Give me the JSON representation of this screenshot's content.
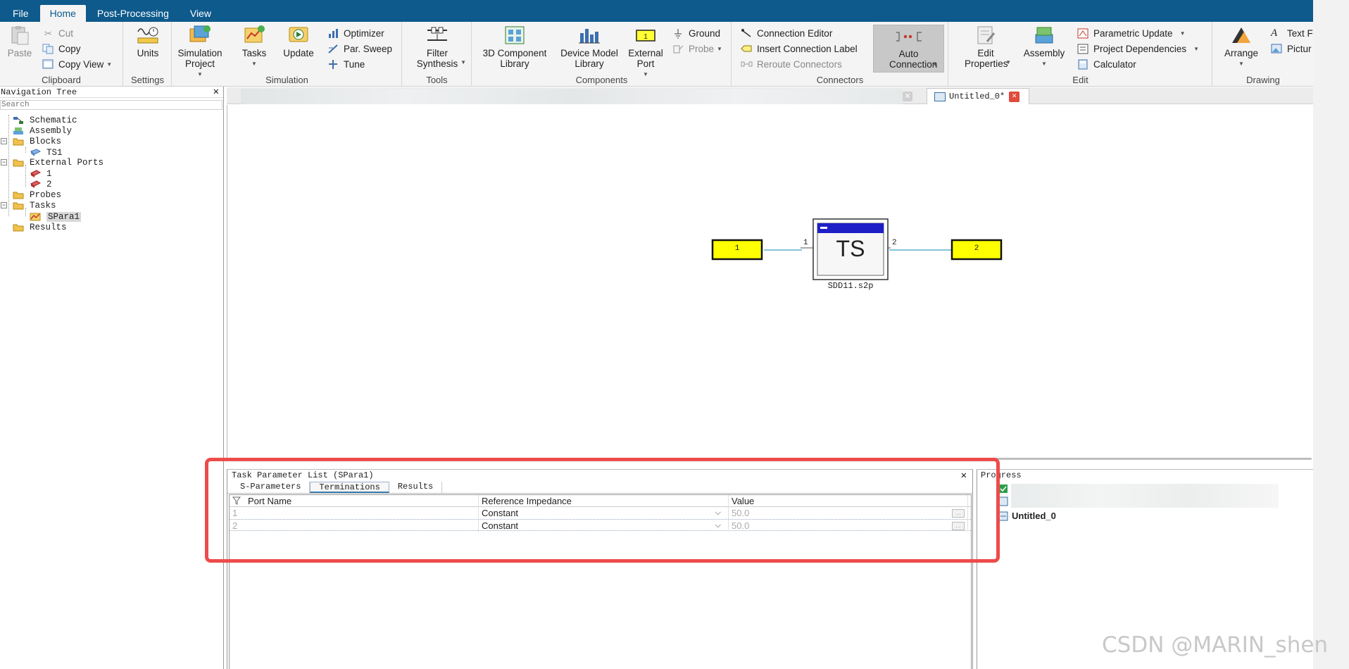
{
  "menu": {
    "tabs": [
      "File",
      "Home",
      "Post-Processing",
      "View"
    ]
  },
  "ribbon": {
    "clipboard": {
      "paste": "Paste",
      "cut": "Cut",
      "copy": "Copy",
      "copy_view": "Copy View",
      "label": "Clipboard"
    },
    "settings": {
      "units": "Units",
      "label": "Settings"
    },
    "simulation": {
      "sim_project": "Simulation Project",
      "tasks": "Tasks",
      "update": "Update",
      "optimizer": "Optimizer",
      "par_sweep": "Par. Sweep",
      "tune": "Tune",
      "label": "Simulation"
    },
    "tools": {
      "filter_synthesis": "Filter Synthesis",
      "label": "Tools"
    },
    "components": {
      "comp3d": "3D Component Library",
      "device_model": "Device Model Library",
      "external_port": "External Port",
      "ground": "Ground",
      "probe": "Probe",
      "label": "Components"
    },
    "connectors": {
      "connection_editor": "Connection Editor",
      "insert_label": "Insert Connection Label",
      "reroute": "Reroute Connectors",
      "auto_connection": "Auto Connection",
      "label": "Connectors"
    },
    "edit": {
      "edit_properties": "Edit Properties",
      "assembly": "Assembly",
      "parametric_update": "Parametric Update",
      "project_dependencies": "Project Dependencies",
      "calculator": "Calculator",
      "label": "Edit"
    },
    "drawing": {
      "arrange": "Arrange",
      "text": "Text F",
      "picture": "Pictur",
      "label": "Drawing"
    }
  },
  "nav": {
    "title": "Navigation Tree",
    "search_placeholder": "Search",
    "items": {
      "schematic": "Schematic",
      "assembly": "Assembly",
      "blocks": "Blocks",
      "ts1": "TS1",
      "external_ports": "External Ports",
      "port1": "1",
      "port2": "2",
      "probes": "Probes",
      "tasks": "Tasks",
      "spara1": "SPara1",
      "results": "Results"
    }
  },
  "doc_tabs": {
    "active": "Untitled_0*"
  },
  "schematic": {
    "port_left": "1",
    "port_right": "2",
    "block_label": "TS",
    "block_file": "SDD11.s2p",
    "pin_left": "1",
    "pin_right": "2"
  },
  "task_panel": {
    "title": "Task Parameter List (SPara1)",
    "tabs": [
      "S-Parameters",
      "Terminations",
      "Results"
    ],
    "columns": [
      "Port Name",
      "Reference Impedance",
      "Value"
    ],
    "rows": [
      {
        "port": "1",
        "impedance": "Constant",
        "value": "50.0"
      },
      {
        "port": "2",
        "impedance": "Constant",
        "value": "50.0"
      }
    ]
  },
  "progress": {
    "title": "Progress",
    "item": "Untitled_0"
  },
  "watermark": "CSDN @MARIN_shen"
}
